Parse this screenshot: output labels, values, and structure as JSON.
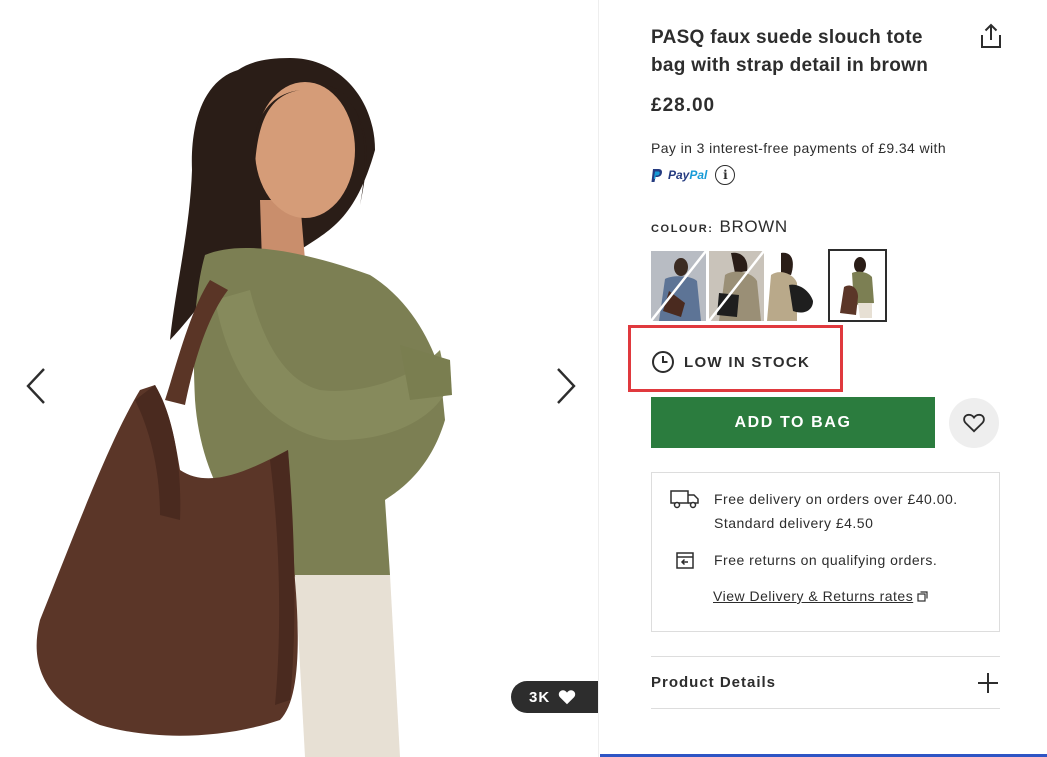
{
  "gallery": {
    "image_alt": "Model wearing brown faux suede slouch tote bag",
    "saves_count": "3K",
    "prev_icon": "chevron-left-icon",
    "next_icon": "chevron-right-icon"
  },
  "product": {
    "title": "PASQ faux suede slouch tote bag with strap detail in brown",
    "price": "£28.00",
    "pay_in_3_text": "Pay in 3 interest-free payments of £9.34 with",
    "paypal_brand": {
      "pay": "Pay",
      "pal": "Pal"
    },
    "info_glyph": "i",
    "colour_label": "COLOUR:",
    "colour_value": "BROWN",
    "swatches": [
      {
        "name": "Blue denim",
        "available": false
      },
      {
        "name": "Black",
        "available": false
      },
      {
        "name": "Black",
        "available": true
      },
      {
        "name": "Brown",
        "available": true,
        "selected": true
      }
    ],
    "stock_status": "LOW IN STOCK",
    "add_to_bag": "ADD TO BAG"
  },
  "delivery": {
    "line1": "Free delivery on orders over £40.00.",
    "line2": "Standard delivery £4.50",
    "returns": "Free returns on qualifying orders.",
    "link": "View Delivery & Returns rates"
  },
  "details": {
    "label": "Product Details",
    "toggle": "+"
  },
  "colors": {
    "accent_green": "#2b7c3e",
    "highlight_red": "#e0393e",
    "text": "#2d2d2d",
    "paypal_blue": "#253b80",
    "paypal_light": "#179bd7"
  }
}
